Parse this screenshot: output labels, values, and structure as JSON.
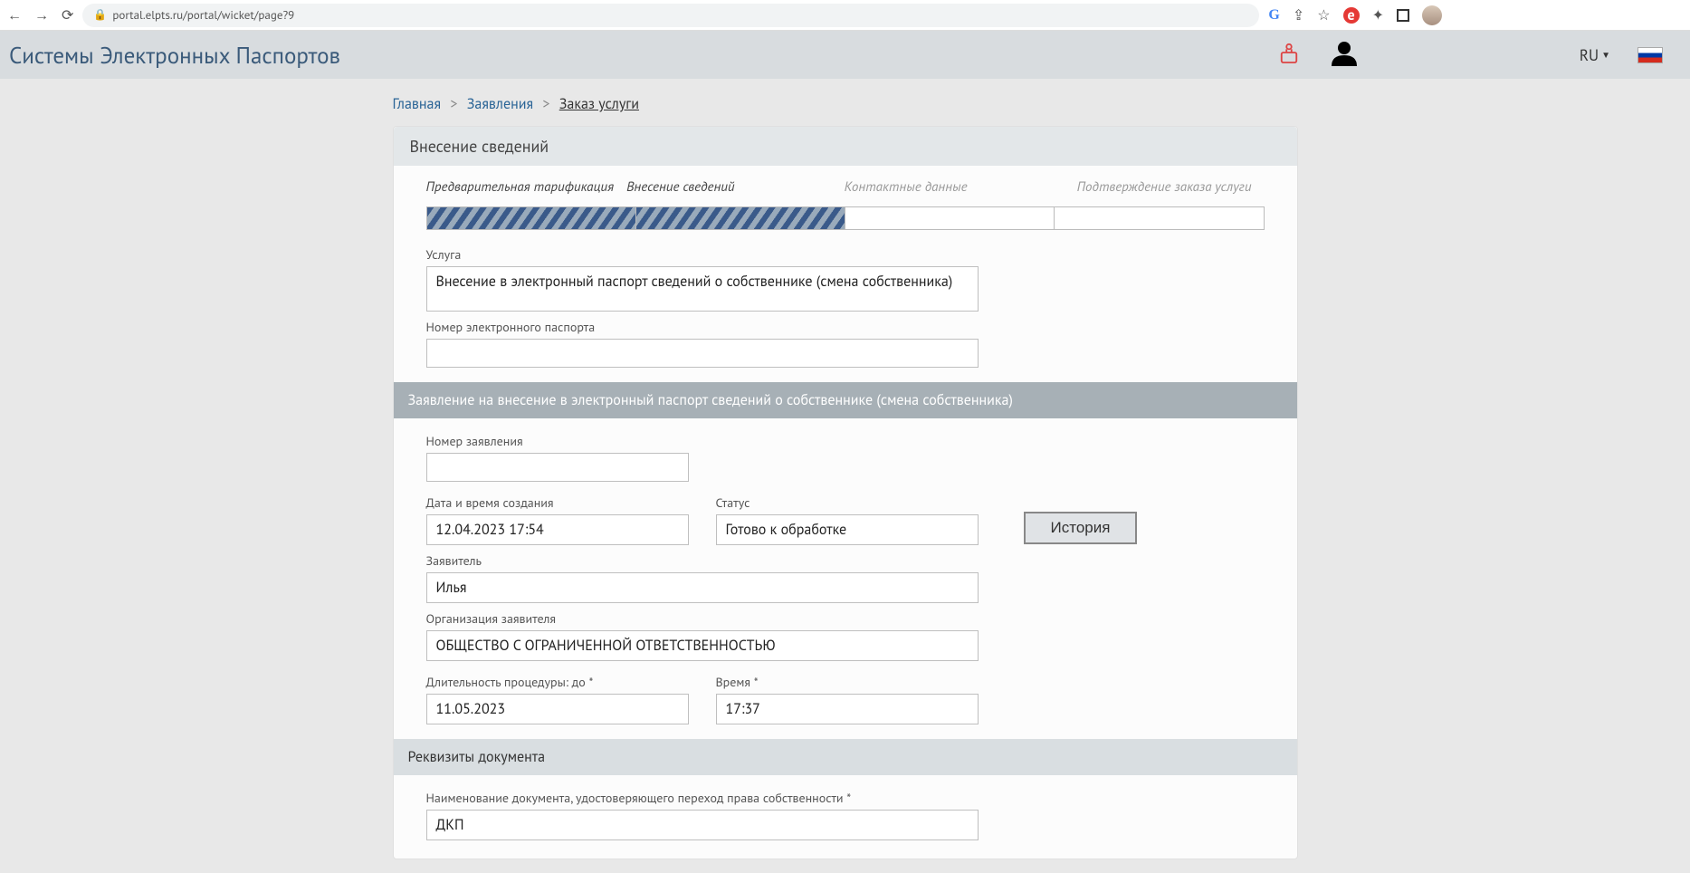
{
  "browser": {
    "url": "portal.elpts.ru/portal/wicket/page?9"
  },
  "header": {
    "app_title": "Системы Электронных Паспортов",
    "lang": "RU"
  },
  "breadcrumb": {
    "home": "Главная",
    "applications": "Заявления",
    "order": "Заказ услуги"
  },
  "panel": {
    "title": "Внесение сведений"
  },
  "steps": {
    "s1": "Предварительная тарификация",
    "s2": "Внесение сведений",
    "s3": "Контактные данные",
    "s4": "Подтверждение заказа услуги"
  },
  "form": {
    "service_label": "Услуга",
    "service_value": "Внесение в электронный паспорт сведений о собственнике (смена собственника)",
    "epassport_num_label": "Номер электронного паспорта",
    "epassport_num_value": "",
    "section_application": "Заявление на внесение в электронный паспорт сведений о собственнике (смена собственника)",
    "app_num_label": "Номер заявления",
    "app_num_value": "",
    "created_label": "Дата и время создания",
    "created_value": "12.04.2023 17:54",
    "status_label": "Статус",
    "status_value": "Готово к обработке",
    "history_btn": "История",
    "applicant_label": "Заявитель",
    "applicant_value": "Илья",
    "org_label": "Организация заявителя",
    "org_value": "ОБЩЕСТВО С ОГРАНИЧЕННОЙ ОТВЕТСТВЕННОСТЬЮ",
    "duration_label": "Длительность процедуры: до *",
    "duration_value": "11.05.2023",
    "time_label": "Время *",
    "time_value": "17:37",
    "section_doc": "Реквизиты документа",
    "doc_name_label": "Наименование документа, удостоверяющего переход права собственности *",
    "doc_name_value": "ДКП"
  }
}
